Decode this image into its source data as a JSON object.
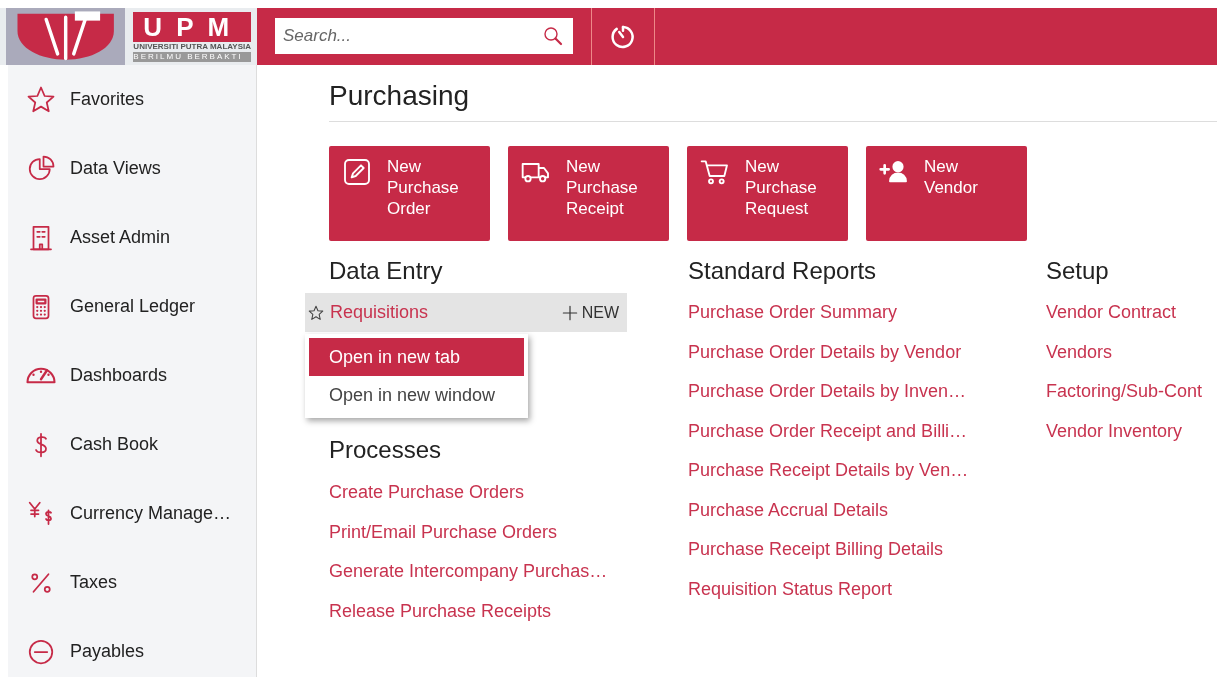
{
  "logo": {
    "acronym": "UPM",
    "name": "UNIVERSITI PUTRA MALAYSIA",
    "motto": "BERILMU BERBAKTI"
  },
  "search": {
    "placeholder": "Search..."
  },
  "sidebar": {
    "items": [
      {
        "label": "Favorites"
      },
      {
        "label": "Data Views"
      },
      {
        "label": "Asset Admin"
      },
      {
        "label": "General Ledger"
      },
      {
        "label": "Dashboards"
      },
      {
        "label": "Cash Book"
      },
      {
        "label": "Currency Manage…"
      },
      {
        "label": "Taxes"
      },
      {
        "label": "Payables"
      }
    ]
  },
  "page_title": "Purchasing",
  "quick_actions": [
    {
      "label": "New Purchase Order"
    },
    {
      "label": "New Purchase Receipt"
    },
    {
      "label": "New Purchase Request"
    },
    {
      "label": "New Vendor"
    }
  ],
  "columns": [
    {
      "sections": [
        {
          "title": "Data Entry",
          "items": [
            {
              "label": "Requisitions",
              "hovered": true,
              "new_label": "NEW",
              "menu": [
                {
                  "label": "Open in new tab",
                  "selected": true
                },
                {
                  "label": "Open in new window",
                  "selected": false
                }
              ]
            }
          ]
        },
        {
          "title": "Processes",
          "items": [
            {
              "label": "Create Purchase Orders"
            },
            {
              "label": "Print/Email Purchase Orders"
            },
            {
              "label": "Generate Intercompany Purchas…"
            },
            {
              "label": "Release Purchase Receipts"
            }
          ]
        }
      ]
    },
    {
      "sections": [
        {
          "title": "Standard Reports",
          "items": [
            {
              "label": "Purchase Order Summary"
            },
            {
              "label": "Purchase Order Details by Vendor"
            },
            {
              "label": "Purchase Order Details by Inven…"
            },
            {
              "label": "Purchase Order Receipt and Billi…"
            },
            {
              "label": "Purchase Receipt Details by Ven…"
            },
            {
              "label": "Purchase Accrual Details"
            },
            {
              "label": "Purchase Receipt Billing Details"
            },
            {
              "label": "Requisition Status Report"
            }
          ]
        }
      ]
    },
    {
      "sections": [
        {
          "title": "Setup",
          "items": [
            {
              "label": "Vendor Contract"
            },
            {
              "label": "Vendors"
            },
            {
              "label": "Factoring/Sub-Cont"
            },
            {
              "label": "Vendor Inventory"
            }
          ]
        }
      ]
    }
  ]
}
